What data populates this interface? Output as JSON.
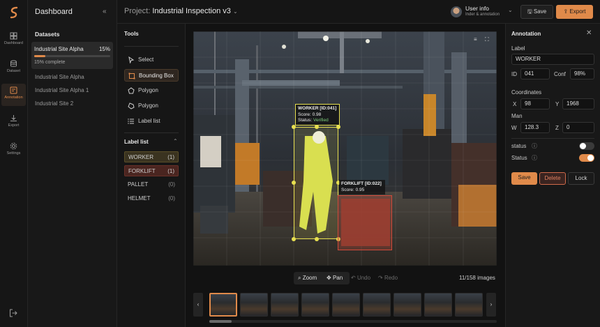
{
  "rail": [
    {
      "label": "Dashboard",
      "icon": "dashboard-icon"
    },
    {
      "label": "Dataset",
      "icon": "database-icon"
    },
    {
      "label": "Annotation",
      "icon": "annotation-icon"
    },
    {
      "label": "Export",
      "icon": "download-icon"
    },
    {
      "label": "Settings",
      "icon": "gear-icon"
    }
  ],
  "sidebar": {
    "title": "Dashboard",
    "datasets_heading": "Datasets",
    "active": {
      "name": "Industrial Site Alpha",
      "percent": "15%",
      "progress": 0.15,
      "status": "15% complete"
    },
    "items": [
      "Industrial Site Alpha",
      "Industrial Site Alpha 1",
      "Industrial Site 2"
    ]
  },
  "header": {
    "project_prefix": "Project:",
    "project_name": "Industrial Inspection v3",
    "user_name": "User info",
    "user_sub": "Inder & annotation",
    "save": "Save",
    "export": "Export"
  },
  "tools": {
    "heading": "Tools",
    "items": [
      "Select",
      "Bounding Box",
      "Polygon",
      "Polygon",
      "Label list"
    ],
    "label_heading": "Label list",
    "labels": [
      {
        "name": "WORKER",
        "count": "(1)"
      },
      {
        "name": "FORKLIFT",
        "count": "(1)"
      },
      {
        "name": "PALLET",
        "count": "(0)"
      },
      {
        "name": "HELMET",
        "count": "(0)"
      }
    ]
  },
  "canvas": {
    "worker_box": {
      "line1": "WORKER [ID:041]",
      "line2": "Score: 0.98",
      "line3_prefix": "Status:",
      "line3_value": "Verified"
    },
    "forklift_box": {
      "line1": "FORKLIFT [ID:022]",
      "line2": "Score: 0.95"
    }
  },
  "controls": {
    "zoom": "Zoom",
    "pan": "Pan",
    "undo": "Undo",
    "redo": "Redo",
    "count": "11/158 images"
  },
  "annotation": {
    "title": "Annotation",
    "label_heading": "Label",
    "label_value": "WORKER",
    "id_label": "ID",
    "id_value": "041",
    "conf_label": "Conf",
    "conf_value": "98%",
    "coords_heading": "Coordinates",
    "x_label": "X",
    "x_value": "98",
    "y_label": "Y",
    "y_value": "1968",
    "man_heading": "Man",
    "w_label": "W",
    "w_value": "128.3",
    "z_label": "Z",
    "z_value": "0",
    "status1": "status",
    "status1_on": false,
    "status2": "Status",
    "status2_on": true,
    "save": "Save",
    "delete": "Delete",
    "lock": "Lock"
  },
  "colors": {
    "accent": "#e08a4a",
    "worker": "#e8e050",
    "forklift": "#d04a3a"
  }
}
